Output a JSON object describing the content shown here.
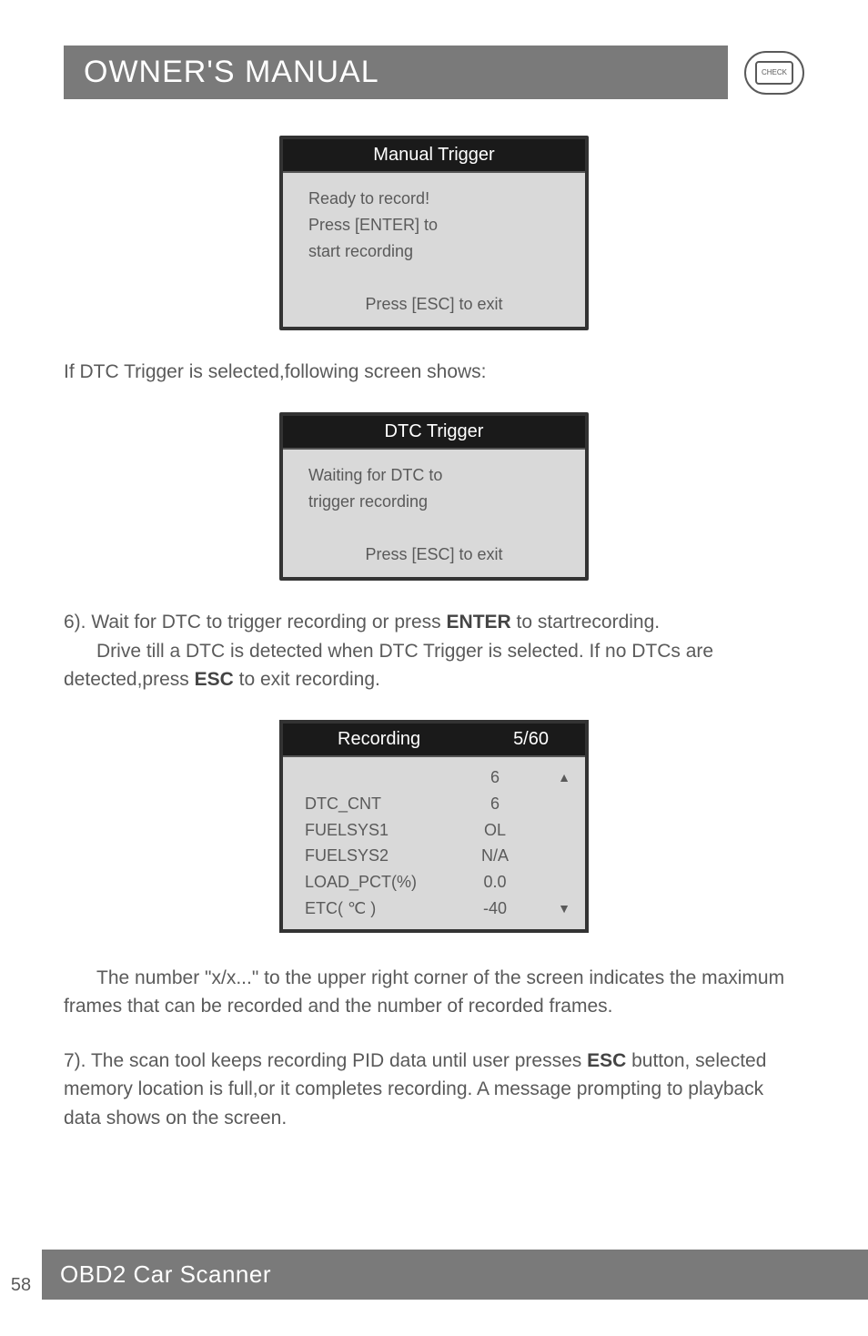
{
  "header": {
    "title": "OWNER'S MANUAL",
    "check_label": "CHECK"
  },
  "box1": {
    "title": "Manual Trigger",
    "line1": "Ready to record!",
    "line2": "Press [ENTER] to",
    "line3": "start recording",
    "footer": "Press [ESC] to exit"
  },
  "para1": "If DTC Trigger is selected,following screen shows:",
  "box2": {
    "title": "DTC Trigger",
    "line1": "Waiting for DTC to",
    "line2": "trigger recording",
    "footer": "Press [ESC] to exit"
  },
  "para2_a": "6). Wait for DTC to trigger recording or press ",
  "para2_bold1": "ENTER",
  "para2_b": " to startrecording.",
  "para2_c": "Drive till a DTC is detected when DTC Trigger is selected. If no DTCs are detected,press ",
  "para2_bold2": "ESC",
  "para2_d": " to exit recording.",
  "box3": {
    "title_left": "Recording",
    "title_right": "5/60",
    "rows": [
      {
        "label": "",
        "value": "6",
        "arrow": "▲"
      },
      {
        "label": "DTC_CNT",
        "value": "6",
        "arrow": ""
      },
      {
        "label": "FUELSYS1",
        "value": "OL",
        "arrow": ""
      },
      {
        "label": "FUELSYS2",
        "value": "N/A",
        "arrow": ""
      },
      {
        "label": "LOAD_PCT(%)",
        "value": "0.0",
        "arrow": ""
      },
      {
        "label": "ETC( ℃ )",
        "value": "-40",
        "arrow": "▼"
      }
    ]
  },
  "para3": "The number \"x/x...\" to the upper right corner of the screen indicates the maximum frames that can be recorded and the number of recorded frames.",
  "para4_a": "7). The scan tool keeps recording PID data until user presses ",
  "para4_bold": "ESC",
  "para4_b": " button, selected memory location is full,or it completes recording. A message prompting to playback data shows on the screen.",
  "footer": {
    "page": "58",
    "label": "OBD2 Car Scanner"
  }
}
